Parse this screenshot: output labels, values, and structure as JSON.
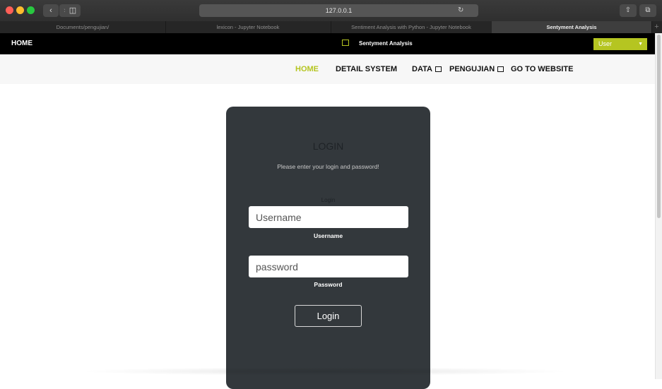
{
  "browser": {
    "url": "127.0.0.1",
    "tabs": [
      {
        "label": "Documents/pengujian/"
      },
      {
        "label": "lexicon - Jupyter Notebook"
      },
      {
        "label": "Sentiment Analysis with Python - Jupyter Notebook"
      },
      {
        "label": "Sentyment Analysis"
      }
    ],
    "new_tab_label": "+"
  },
  "topbar": {
    "home_label": "HOME",
    "brand": "Sentyment Analysis",
    "user_button": "User",
    "accent_color": "#b5c521"
  },
  "nav": {
    "items": [
      {
        "label": "HOME"
      },
      {
        "label": "DETAIL SYSTEM"
      },
      {
        "label": "DATA"
      },
      {
        "label": "PENGUJIAN"
      },
      {
        "label": "GO TO WEBSITE"
      }
    ]
  },
  "login": {
    "title": "LOGIN",
    "subtitle": "Please enter your login and password!",
    "caption": "Login",
    "username_placeholder": "Username",
    "username_label": "Username",
    "password_placeholder": "password",
    "password_label": "Password",
    "submit_label": "Login"
  }
}
